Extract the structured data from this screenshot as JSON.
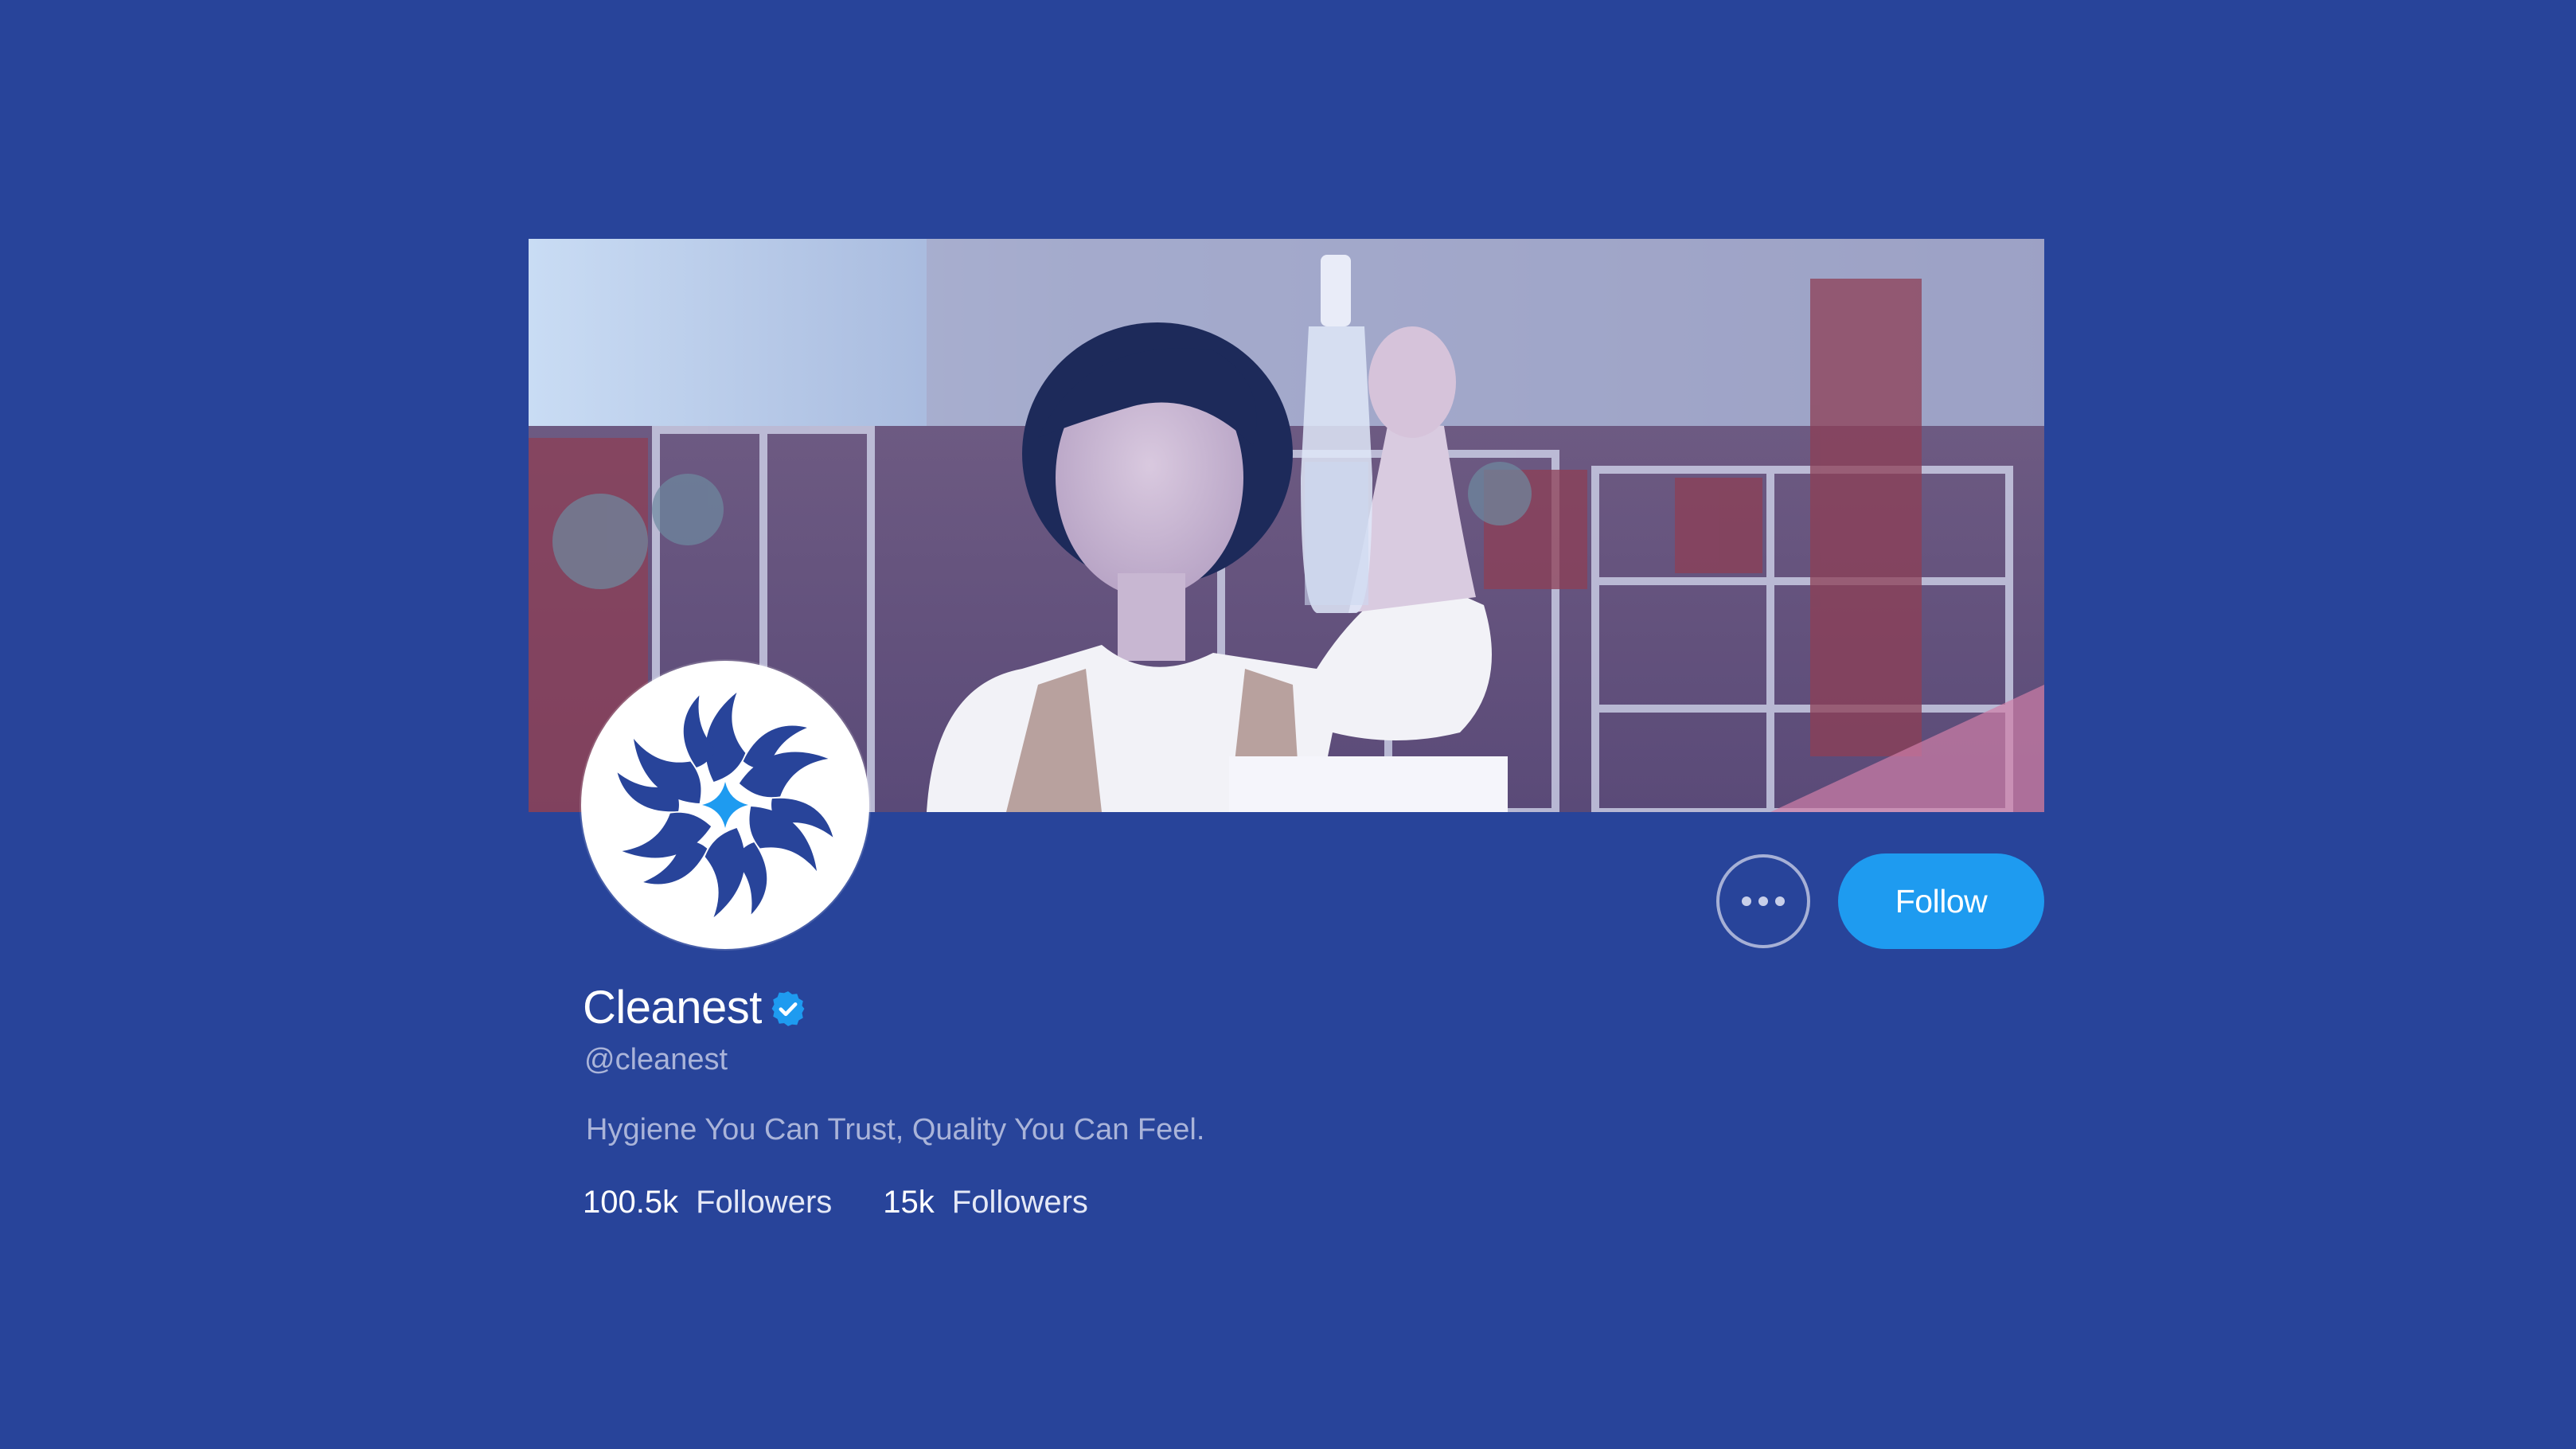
{
  "profile": {
    "display_name": "Cleanest",
    "handle": "@cleanest",
    "bio": "Hygiene You Can Trust, Quality You Can Feel.",
    "verified": true
  },
  "actions": {
    "more_icon": "ellipsis-icon",
    "follow_label": "Follow"
  },
  "stats": [
    {
      "count": "100.5k",
      "label": "Followers"
    },
    {
      "count": "15k",
      "label": "Followers"
    }
  ],
  "cover": {
    "description_icon": "cover-photo"
  },
  "avatar": {
    "icon": "cleanest-logo"
  },
  "colors": {
    "background": "#28449a",
    "accent": "#1e9bf0",
    "text_primary": "#ffffff",
    "text_secondary": "#aab4d9",
    "logo": "#28449a",
    "logo_star": "#1e9bf0"
  }
}
